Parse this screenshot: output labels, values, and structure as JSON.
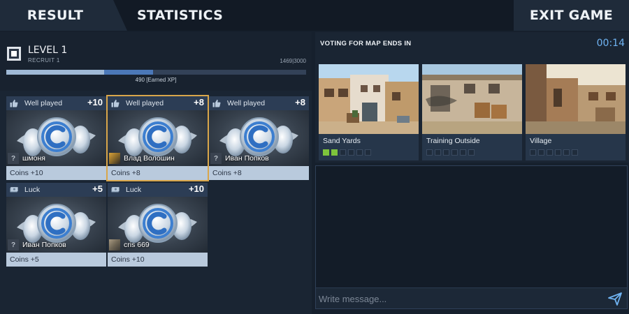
{
  "nav": {
    "result_label": "RESULT",
    "statistics_label": "STATISTICS",
    "exit_label": "EXIT GAME"
  },
  "level": {
    "title": "LEVEL 1",
    "subtitle": "RECRUIT 1",
    "xp_current": 1469,
    "xp_max": 3000,
    "xp_text": "1469|3000",
    "xp_earned": 490,
    "earned_text": "490 [Earned XP]",
    "icon": "rank-square-icon"
  },
  "cards": [
    {
      "category": "Well played",
      "category_icon": "thumbs-up-icon",
      "value": "+10",
      "player": "шмоня",
      "avatar": "unknown-avatar",
      "avatar_glyph": "?",
      "reward_label": "Coins",
      "reward_value": "+10",
      "highlighted": false
    },
    {
      "category": "Well played",
      "category_icon": "thumbs-up-icon",
      "value": "+8",
      "player": "Влад Волошин",
      "avatar": "player-avatar",
      "avatar_glyph": "",
      "reward_label": "Coins",
      "reward_value": "+8",
      "highlighted": true
    },
    {
      "category": "Well played",
      "category_icon": "thumbs-up-icon",
      "value": "+8",
      "player": "Иван Попков",
      "avatar": "unknown-avatar",
      "avatar_glyph": "?",
      "reward_label": "Coins",
      "reward_value": "+8",
      "highlighted": false
    },
    {
      "category": "Luck",
      "category_icon": "cash-icon",
      "value": "+5",
      "player": "Иван Попков",
      "avatar": "unknown-avatar",
      "avatar_glyph": "?",
      "reward_label": "Coins",
      "reward_value": "+5",
      "highlighted": false
    },
    {
      "category": "Luck",
      "category_icon": "cash-icon",
      "value": "+10",
      "player": "cris 669",
      "avatar": "player-avatar",
      "avatar_glyph": "",
      "reward_label": "Coins",
      "reward_value": "+10",
      "highlighted": false
    }
  ],
  "voting": {
    "title": "VOTING FOR MAP ENDS IN",
    "timer": "00:14",
    "maps": [
      {
        "name": "Sand Yards",
        "votes": 2,
        "slots": 6
      },
      {
        "name": "Training Outside",
        "votes": 0,
        "slots": 6
      },
      {
        "name": "Village",
        "votes": 0,
        "slots": 6
      }
    ]
  },
  "chat": {
    "placeholder": "Write message...",
    "send_icon": "send-icon"
  },
  "colors": {
    "accent": "#6fb3f2",
    "highlight": "#d9a64a",
    "vote_on": "#7ec33c"
  }
}
